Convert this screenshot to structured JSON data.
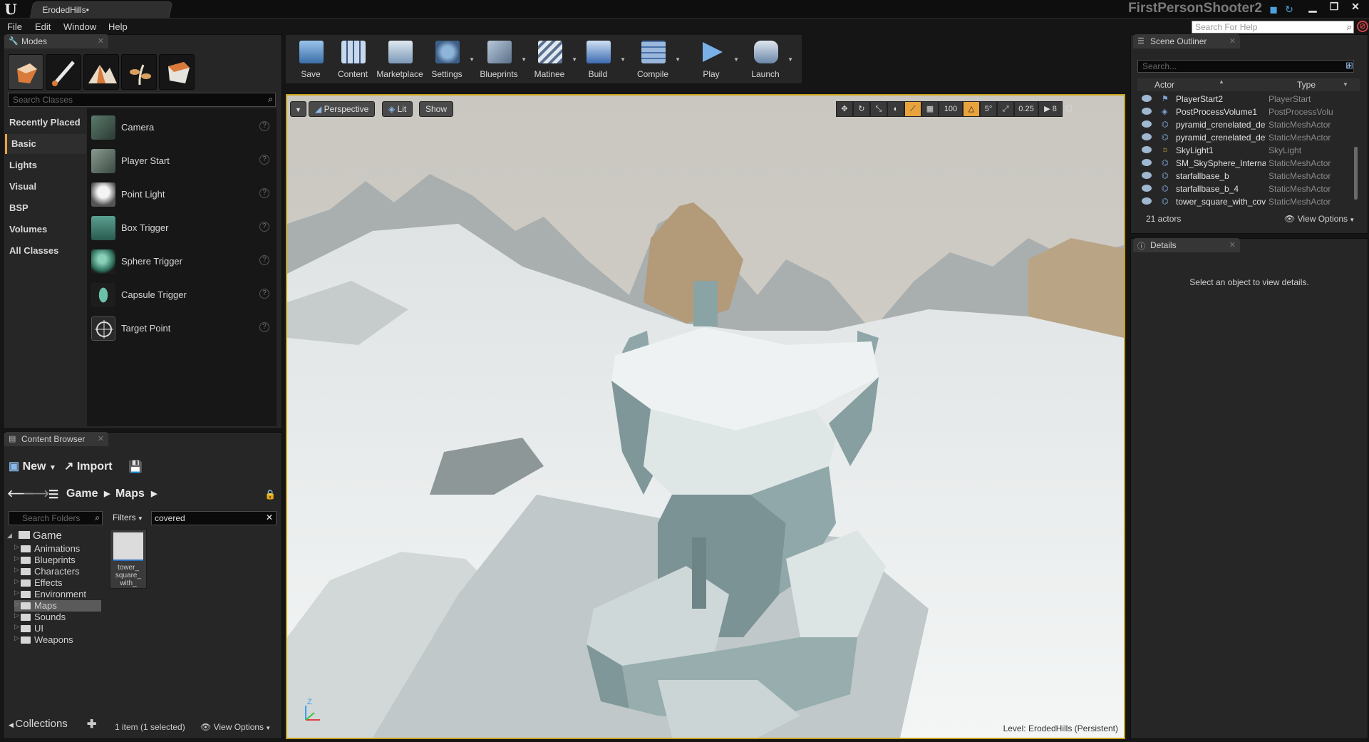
{
  "window": {
    "doc_tab": "ErodedHills•",
    "project_title": "FirstPersonShooter2",
    "help_search_placeholder": "Search For Help"
  },
  "menu": [
    "File",
    "Edit",
    "Window",
    "Help"
  ],
  "modes": {
    "tab_label": "Modes",
    "search_placeholder": "Search Classes",
    "mode_icons": [
      "place-mode-icon",
      "paint-mode-icon",
      "landscape-mode-icon",
      "foliage-mode-icon",
      "geometry-mode-icon"
    ],
    "categories": [
      "Recently Placed",
      "Basic",
      "Lights",
      "Visual",
      "BSP",
      "Volumes",
      "All Classes"
    ],
    "active_category": "Basic",
    "items": [
      "Camera",
      "Player Start",
      "Point Light",
      "Box Trigger",
      "Sphere Trigger",
      "Capsule Trigger",
      "Target Point"
    ]
  },
  "toolbar": [
    {
      "label": "Save",
      "icon": "save-icon"
    },
    {
      "label": "Content",
      "icon": "content-icon"
    },
    {
      "label": "Marketplace",
      "icon": "marketplace-icon"
    },
    {
      "label": "Settings",
      "icon": "settings-icon"
    },
    {
      "label": "Blueprints",
      "icon": "blueprints-icon"
    },
    {
      "label": "Matinee",
      "icon": "matinee-icon"
    },
    {
      "label": "Build",
      "icon": "build-icon"
    },
    {
      "label": "Compile",
      "icon": "compile-icon"
    },
    {
      "label": "Play",
      "icon": "play-icon"
    },
    {
      "label": "Launch",
      "icon": "launch-icon"
    }
  ],
  "viewport": {
    "perspective_label": "Perspective",
    "lit_label": "Lit",
    "show_label": "Show",
    "grid_snap": "100",
    "rotation_snap": "5°",
    "scale_snap": "0.25",
    "camera_speed": "8",
    "level_prefix": "Level:",
    "level_name": "ErodedHills (Persistent)",
    "axis_z": "Z"
  },
  "content_browser": {
    "tab_label": "Content Browser",
    "new_label": "New",
    "import_label": "Import",
    "path": [
      "Game",
      "Maps"
    ],
    "folder_search_placeholder": "Search Folders",
    "filters_label": "Filters",
    "filter_value": "covered",
    "tree_root": "Game",
    "folders": [
      "Animations",
      "Blueprints",
      "Characters",
      "Effects",
      "Environment",
      "Maps",
      "Sounds",
      "UI",
      "Weapons"
    ],
    "selected_folder": "Maps",
    "asset_caption": "tower_ square_ with_",
    "collections_label": "Collections",
    "status": "1 item (1 selected)",
    "view_options": "View Options"
  },
  "outliner": {
    "tab_label": "Scene Outliner",
    "search_placeholder": "Search...",
    "col_actor": "Actor",
    "col_type": "Type",
    "rows": [
      {
        "name": "PlayerStart2",
        "type": "PlayerStart"
      },
      {
        "name": "PostProcessVolume1",
        "type": "PostProcessVolume"
      },
      {
        "name": "pyramid_crenelated_details_b",
        "type": "StaticMeshActor"
      },
      {
        "name": "pyramid_crenelated_details_b",
        "type": "StaticMeshActor"
      },
      {
        "name": "SkyLight1",
        "type": "SkyLight"
      },
      {
        "name": "SM_SkySphere_Internal",
        "type": "StaticMeshActor"
      },
      {
        "name": "starfallbase_b",
        "type": "StaticMeshActor"
      },
      {
        "name": "starfallbase_b_4",
        "type": "StaticMeshActor"
      },
      {
        "name": "tower_square_with_covered_p",
        "type": "StaticMeshActor"
      }
    ],
    "actor_count": "21 actors",
    "view_options": "View Options"
  },
  "details": {
    "tab_label": "Details",
    "empty_message": "Select an object to view details."
  },
  "colors": {
    "accent": "#e8a33c",
    "viewport_border": "#c8a21c",
    "selection": "#5a5a5a"
  }
}
